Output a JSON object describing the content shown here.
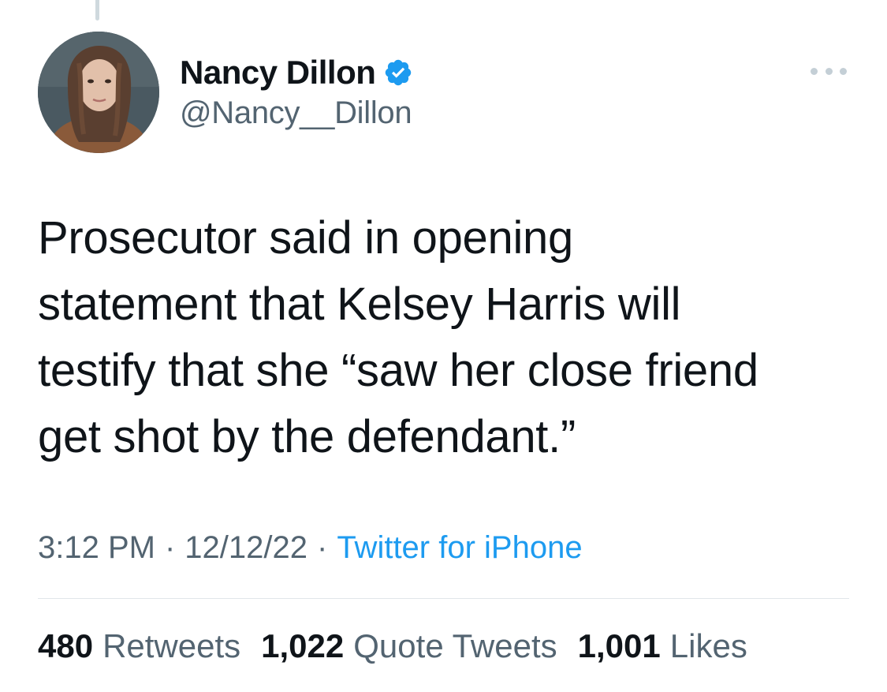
{
  "author": {
    "display_name": "Nancy Dillon",
    "handle": "@Nancy__Dillon",
    "verified": true,
    "verified_icon": "verified-badge-icon",
    "avatar": "avatar-photo"
  },
  "tweet": {
    "text_lines": [
      "Prosecutor said in opening",
      "statement that Kelsey Harris will",
      "testify that she “saw her close friend",
      "get shot by the defendant.”"
    ]
  },
  "meta": {
    "time": "3:12 PM",
    "separator": "·",
    "date": "12/12/22",
    "source": "Twitter for iPhone"
  },
  "stats": {
    "retweets": {
      "count": "480",
      "label": "Retweets"
    },
    "quote_tweets": {
      "count": "1,022",
      "label": "Quote Tweets"
    },
    "likes": {
      "count": "1,001",
      "label": "Likes"
    }
  },
  "colors": {
    "text": "#0f1419",
    "secondary": "#536471",
    "accent": "#1d9bf0",
    "divider": "#e1e6ea"
  },
  "icons": {
    "more": "more-options-icon"
  }
}
